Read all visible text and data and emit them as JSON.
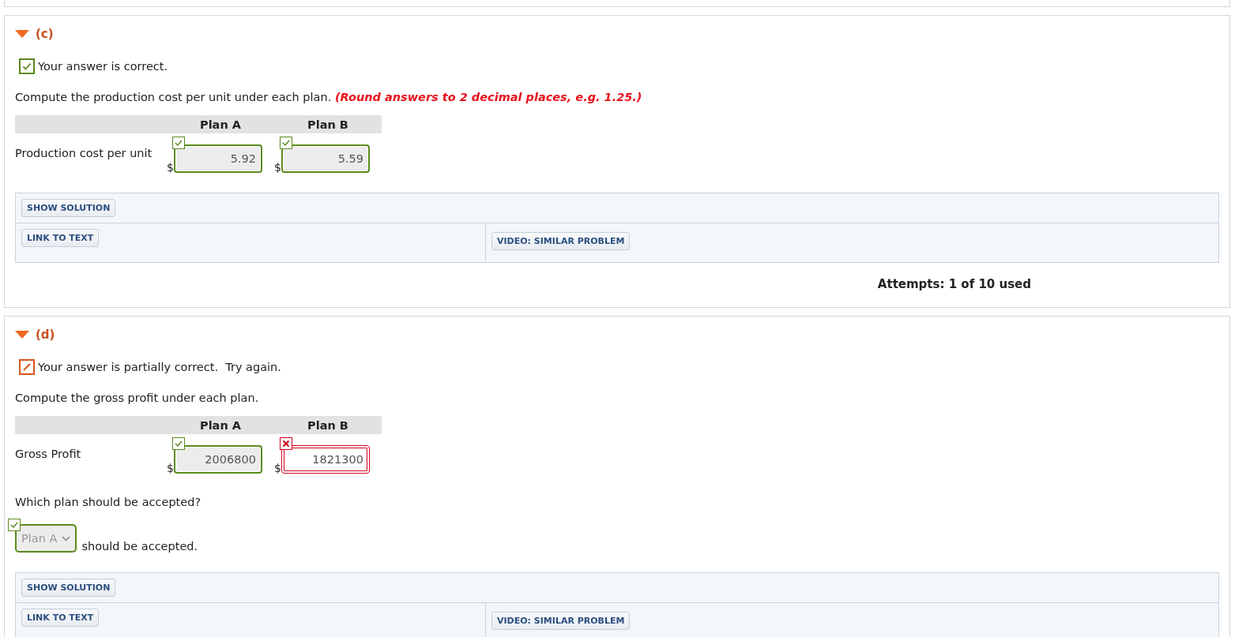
{
  "sections": [
    {
      "label": "(c)",
      "expanded": true,
      "status": {
        "kind": "correct",
        "text": "Your answer is correct."
      },
      "prompt": "Compute the production cost per unit under each plan.",
      "prompt_note": "(Round answers to 2 decimal places, e.g. 1.25.)",
      "table": {
        "columns": [
          "Plan A",
          "Plan B"
        ],
        "rows": [
          {
            "label": "Production cost per unit",
            "cells": [
              {
                "currency": "$",
                "value": "5.92",
                "correct": true
              },
              {
                "currency": "$",
                "value": "5.59",
                "correct": true
              }
            ]
          }
        ]
      },
      "buttons": {
        "show_solution": "SHOW SOLUTION",
        "link_to_text": "LINK TO TEXT",
        "video": "VIDEO: SIMILAR PROBLEM"
      },
      "attempts": "Attempts: 1 of 10 used"
    },
    {
      "label": "(d)",
      "expanded": true,
      "status": {
        "kind": "partial",
        "text": "Your answer is partially correct.  Try again."
      },
      "prompt": "Compute the gross profit under each plan.",
      "table": {
        "columns": [
          "Plan A",
          "Plan B"
        ],
        "rows": [
          {
            "label": "Gross Profit",
            "cells": [
              {
                "currency": "$",
                "value": "2006800",
                "correct": true
              },
              {
                "currency": "$",
                "value": "1821300",
                "correct": false
              }
            ]
          }
        ]
      },
      "question": "Which plan should be accepted?",
      "choice": {
        "value": "Plan A",
        "correct": true,
        "suffix": "should be accepted."
      },
      "buttons": {
        "show_solution": "SHOW SOLUTION",
        "link_to_text": "LINK TO TEXT",
        "video": "VIDEO: SIMILAR PROBLEM"
      }
    }
  ]
}
